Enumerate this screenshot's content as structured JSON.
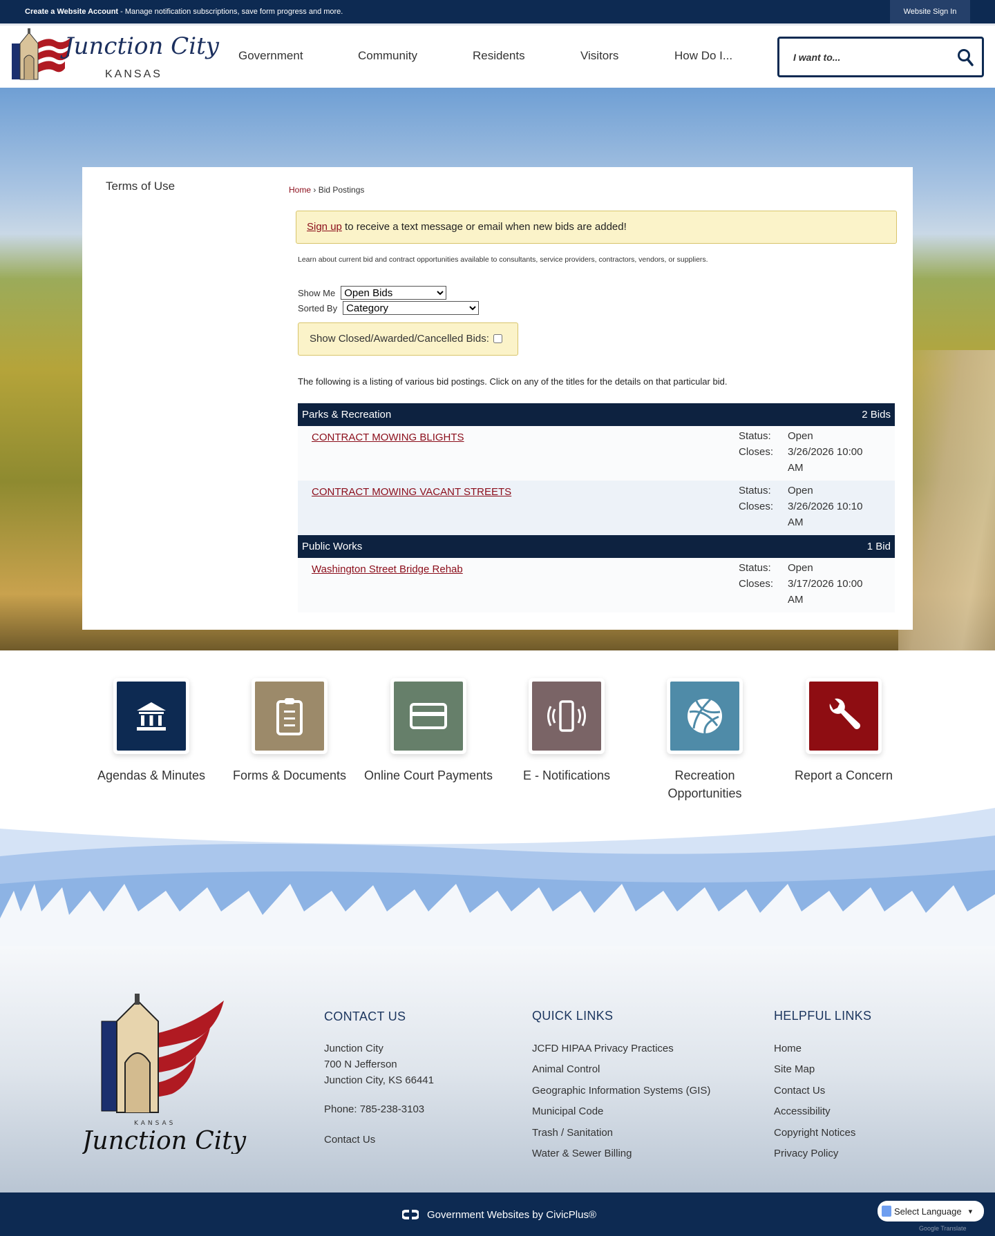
{
  "topbar": {
    "create_account": "Create a Website Account",
    "message": " - Manage notification subscriptions, save form progress and more.",
    "signin": "Website Sign In"
  },
  "logo": {
    "name": "Junction City",
    "state": "KANSAS"
  },
  "nav": [
    "Government",
    "Community",
    "Residents",
    "Visitors",
    "How Do I..."
  ],
  "search": {
    "placeholder": "I want to..."
  },
  "sidebar": {
    "item": "Terms of Use"
  },
  "breadcrumb": {
    "home": "Home",
    "sep": "›",
    "current": "Bid Postings"
  },
  "alert": {
    "link": "Sign up",
    "text": " to receive a text message or email when new bids are added!"
  },
  "intro": "Learn about current bid and contract opportunities available to consultants, service providers, contractors, vendors, or suppliers.",
  "filters": {
    "show_me_label": "Show Me",
    "show_me_value": "Open Bids",
    "sorted_by_label": "Sorted By",
    "sorted_by_value": "Category",
    "closed_label": "Show Closed/Awarded/Cancelled Bids:"
  },
  "listing_text": "The following is a listing of various bid postings. Click on any of the titles for the details on that particular bid.",
  "categories": [
    {
      "name": "Parks & Recreation",
      "count": "2 Bids",
      "bids": [
        {
          "title": "CONTRACT MOWING BLIGHTS",
          "status_label": "Status:",
          "status": "Open",
          "closes_label": "Closes:",
          "closes": "3/26/2026 10:00 AM"
        },
        {
          "title": "CONTRACT MOWING VACANT STREETS",
          "status_label": "Status:",
          "status": "Open",
          "closes_label": "Closes:",
          "closes": "3/26/2026 10:10 AM"
        }
      ]
    },
    {
      "name": "Public Works",
      "count": "1 Bid",
      "bids": [
        {
          "title": "Washington Street Bridge Rehab",
          "status_label": "Status:",
          "status": "Open",
          "closes_label": "Closes:",
          "closes": "3/17/2026 10:00 AM"
        }
      ]
    }
  ],
  "quick_links": [
    {
      "label": "Agendas & Minutes",
      "icon": "building-icon",
      "color": "#0d2a52"
    },
    {
      "label": "Forms & Documents",
      "icon": "clipboard-icon",
      "color": "#9c8a6a"
    },
    {
      "label": "Online Court Payments",
      "icon": "credit-card-icon",
      "color": "#667f6a"
    },
    {
      "label": "E - Notifications",
      "icon": "phone-vibrate-icon",
      "color": "#7a6466"
    },
    {
      "label": "Recreation Opportunities",
      "icon": "basketball-icon",
      "color": "#4f8ba8"
    },
    {
      "label": "Report a Concern",
      "icon": "wrench-icon",
      "color": "#8e0d12"
    }
  ],
  "footer": {
    "contact": {
      "heading": "CONTACT US",
      "name": "Junction City",
      "address1": "700 N Jefferson",
      "address2": "Junction City, KS 66441",
      "phone": "Phone: 785-238-3103",
      "link": "Contact Us"
    },
    "quick": {
      "heading": "QUICK LINKS",
      "links": [
        "JCFD HIPAA Privacy Practices",
        "Animal Control",
        "Geographic Information Systems (GIS)",
        "Municipal Code",
        "Trash / Sanitation",
        "Water & Sewer Billing"
      ]
    },
    "helpful": {
      "heading": "HELPFUL LINKS",
      "links": [
        "Home",
        "Site Map",
        "Contact Us",
        "Accessibility",
        "Copyright Notices",
        "Privacy Policy"
      ]
    }
  },
  "bottom": {
    "credit": "Government Websites by CivicPlus®",
    "language": "Select Language",
    "powered": "Google Translate"
  }
}
